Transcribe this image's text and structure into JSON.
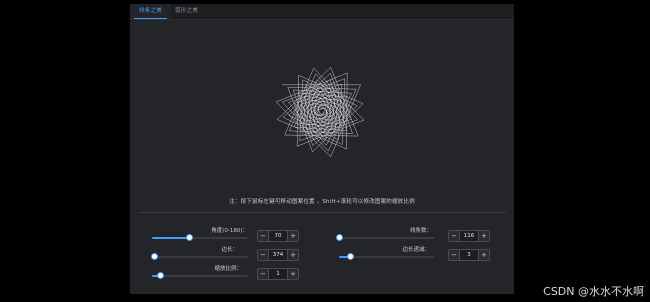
{
  "tabs": [
    {
      "label": "线条之美",
      "active": true
    },
    {
      "label": "弧形之美",
      "active": false
    }
  ],
  "hint": "注：按下鼠标左键可移动图案位置 ，Shift+滚轮可以修改图案的缩放比例",
  "controls": {
    "angle": {
      "label": "角度(0-180)：",
      "value": "70",
      "fraction": 0.39
    },
    "line_count": {
      "label": "线条数：",
      "value": "116",
      "fraction": 0.0
    },
    "length": {
      "label": "边长：",
      "value": "374",
      "fraction": 0.03
    },
    "length_growth": {
      "label": "边长递减：",
      "value": "3",
      "fraction": 0.12
    },
    "scale": {
      "label": "缩放比例：",
      "value": "1",
      "fraction": 0.09
    }
  },
  "stepper_icons": {
    "minus": "−",
    "plus": "+"
  },
  "colors": {
    "accent": "#409eff",
    "panel": "#242528",
    "background": "#000000"
  },
  "watermark": "CSDN @水水不水啊"
}
